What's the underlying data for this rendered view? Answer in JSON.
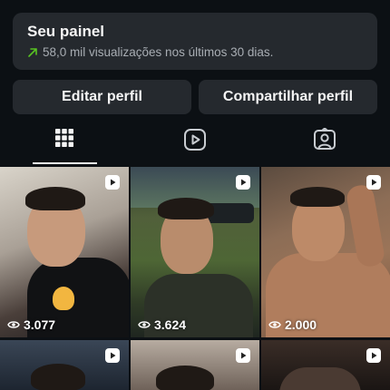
{
  "dashboard": {
    "title": "Seu painel",
    "trend_icon": "trend-up-arrow-icon",
    "subtitle": "58,0 mil visualizações nos últimos 30 dias."
  },
  "actions": {
    "edit_label": "Editar perfil",
    "share_label": "Compartilhar perfil"
  },
  "tabs": [
    {
      "name": "grid",
      "icon": "grid-icon",
      "active": true
    },
    {
      "name": "reels",
      "icon": "reels-icon",
      "active": false
    },
    {
      "name": "tagged",
      "icon": "tagged-icon",
      "active": false
    }
  ],
  "posts": [
    {
      "type": "reel",
      "views": "3.077"
    },
    {
      "type": "reel",
      "views": "3.624"
    },
    {
      "type": "reel",
      "views": "2.000"
    },
    {
      "type": "reel",
      "views": ""
    },
    {
      "type": "reel",
      "views": ""
    },
    {
      "type": "reel",
      "views": ""
    }
  ],
  "colors": {
    "background": "#0c1014",
    "card": "#25292e",
    "trend_green": "#58c322",
    "text_primary": "#f5f5f5",
    "text_secondary": "#a8adb3"
  }
}
